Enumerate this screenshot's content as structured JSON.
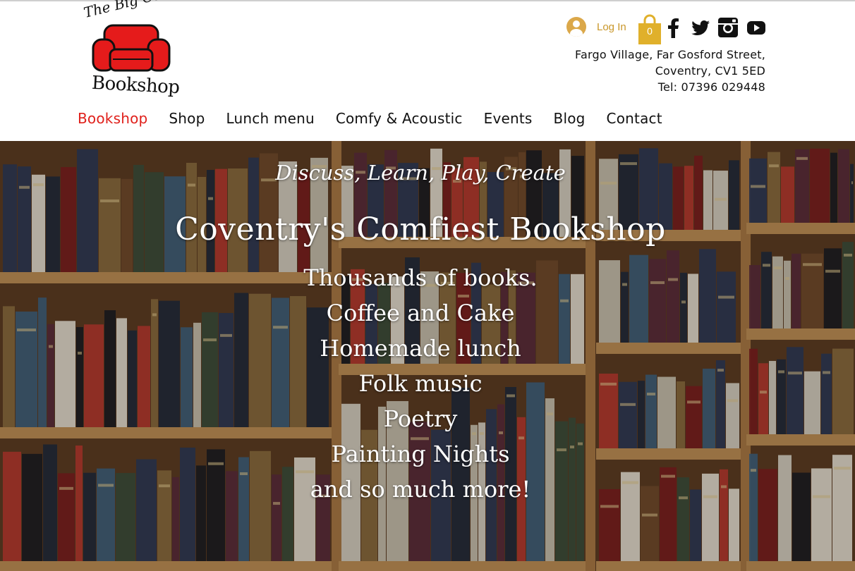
{
  "logo": {
    "top_text": "The Big Comfy",
    "bottom_text": "Bookshop",
    "chair_color": "#e51b1b"
  },
  "header": {
    "login_label": "Log In",
    "login_icon": "user-avatar-icon",
    "cart_count": "0",
    "cart_color": "#e0b02b",
    "social": [
      "facebook-icon",
      "twitter-icon",
      "instagram-icon",
      "youtube-icon"
    ],
    "address": {
      "line1": "Fargo Village, Far Gosford Street,",
      "line2": "Coventry, CV1 5ED",
      "line3": "Tel: 07396 029448"
    }
  },
  "nav": {
    "items": [
      "Bookshop",
      "Shop",
      "Lunch menu",
      "Comfy & Acoustic",
      "Events",
      "Blog",
      "Contact"
    ],
    "active": "Bookshop",
    "active_color": "#e0201b"
  },
  "hero": {
    "tagline": "Discuss, Learn, Play, Create",
    "headline": "Coventry's Comfiest  Bookshop",
    "lines": [
      "Thousands of books.",
      "Coffee and Cake",
      "Homemade lunch",
      "Folk music",
      "Poetry",
      "Painting Nights",
      "and so much more!"
    ]
  }
}
